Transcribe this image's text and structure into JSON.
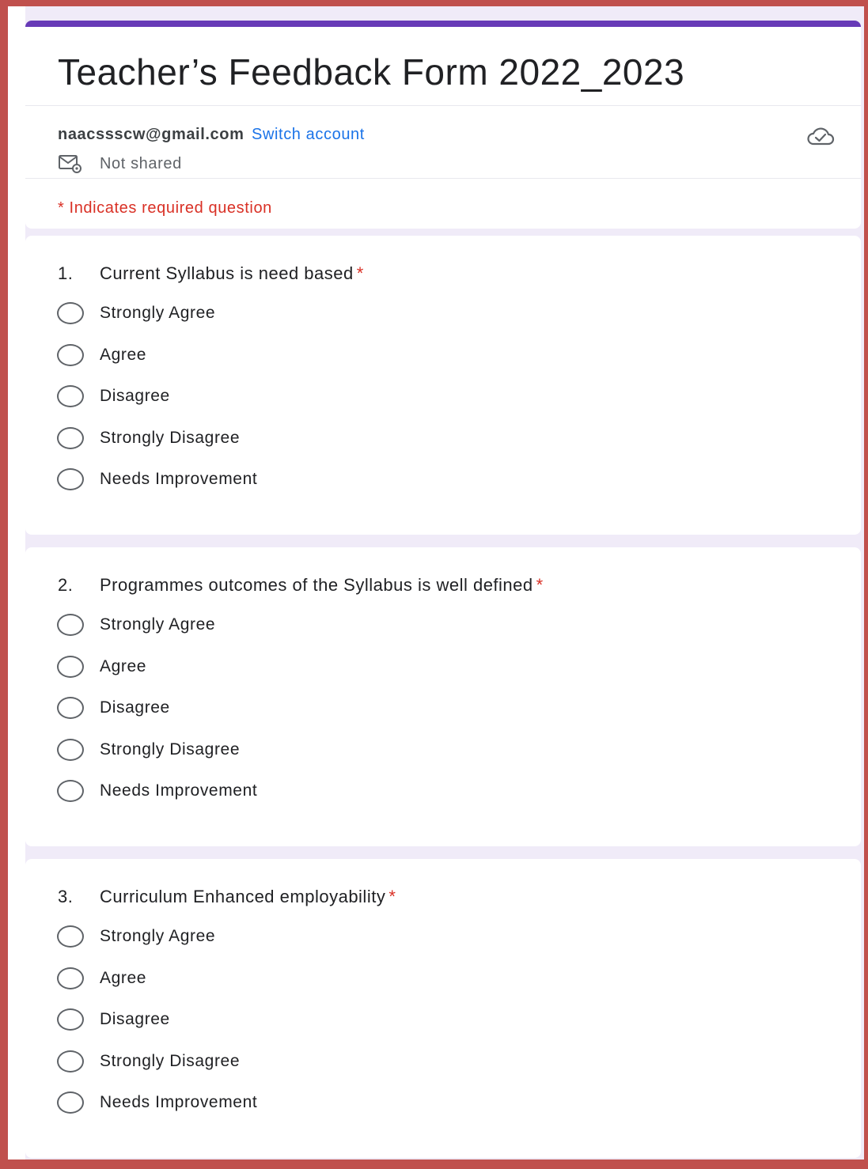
{
  "form": {
    "title": "Teacher’s Feedback Form 2022_2023",
    "account_email": "naacssscw@gmail.com",
    "switch_account": "Switch account",
    "shared_status": "Not shared",
    "required_note": "* Indicates required question",
    "accent_color": "#673ab7",
    "required_color": "#d93025",
    "link_color": "#1a73e8"
  },
  "icons": {
    "mail": "mail-settings-icon",
    "cloud": "cloud-check-icon"
  },
  "questions": [
    {
      "number": "1.",
      "text": "Current Syllabus is need based",
      "required_mark": "*",
      "options": [
        "Strongly Agree",
        "Agree",
        "Disagree",
        "Strongly Disagree",
        "Needs Improvement"
      ]
    },
    {
      "number": "2.",
      "text": "Programmes outcomes of the Syllabus is well defined",
      "required_mark": "*",
      "options": [
        "Strongly Agree",
        "Agree",
        "Disagree",
        "Strongly Disagree",
        "Needs Improvement"
      ]
    },
    {
      "number": "3.",
      "text": "Curriculum Enhanced employability",
      "required_mark": "*",
      "options": [
        "Strongly Agree",
        "Agree",
        "Disagree",
        "Strongly Disagree",
        "Needs Improvement"
      ]
    }
  ]
}
